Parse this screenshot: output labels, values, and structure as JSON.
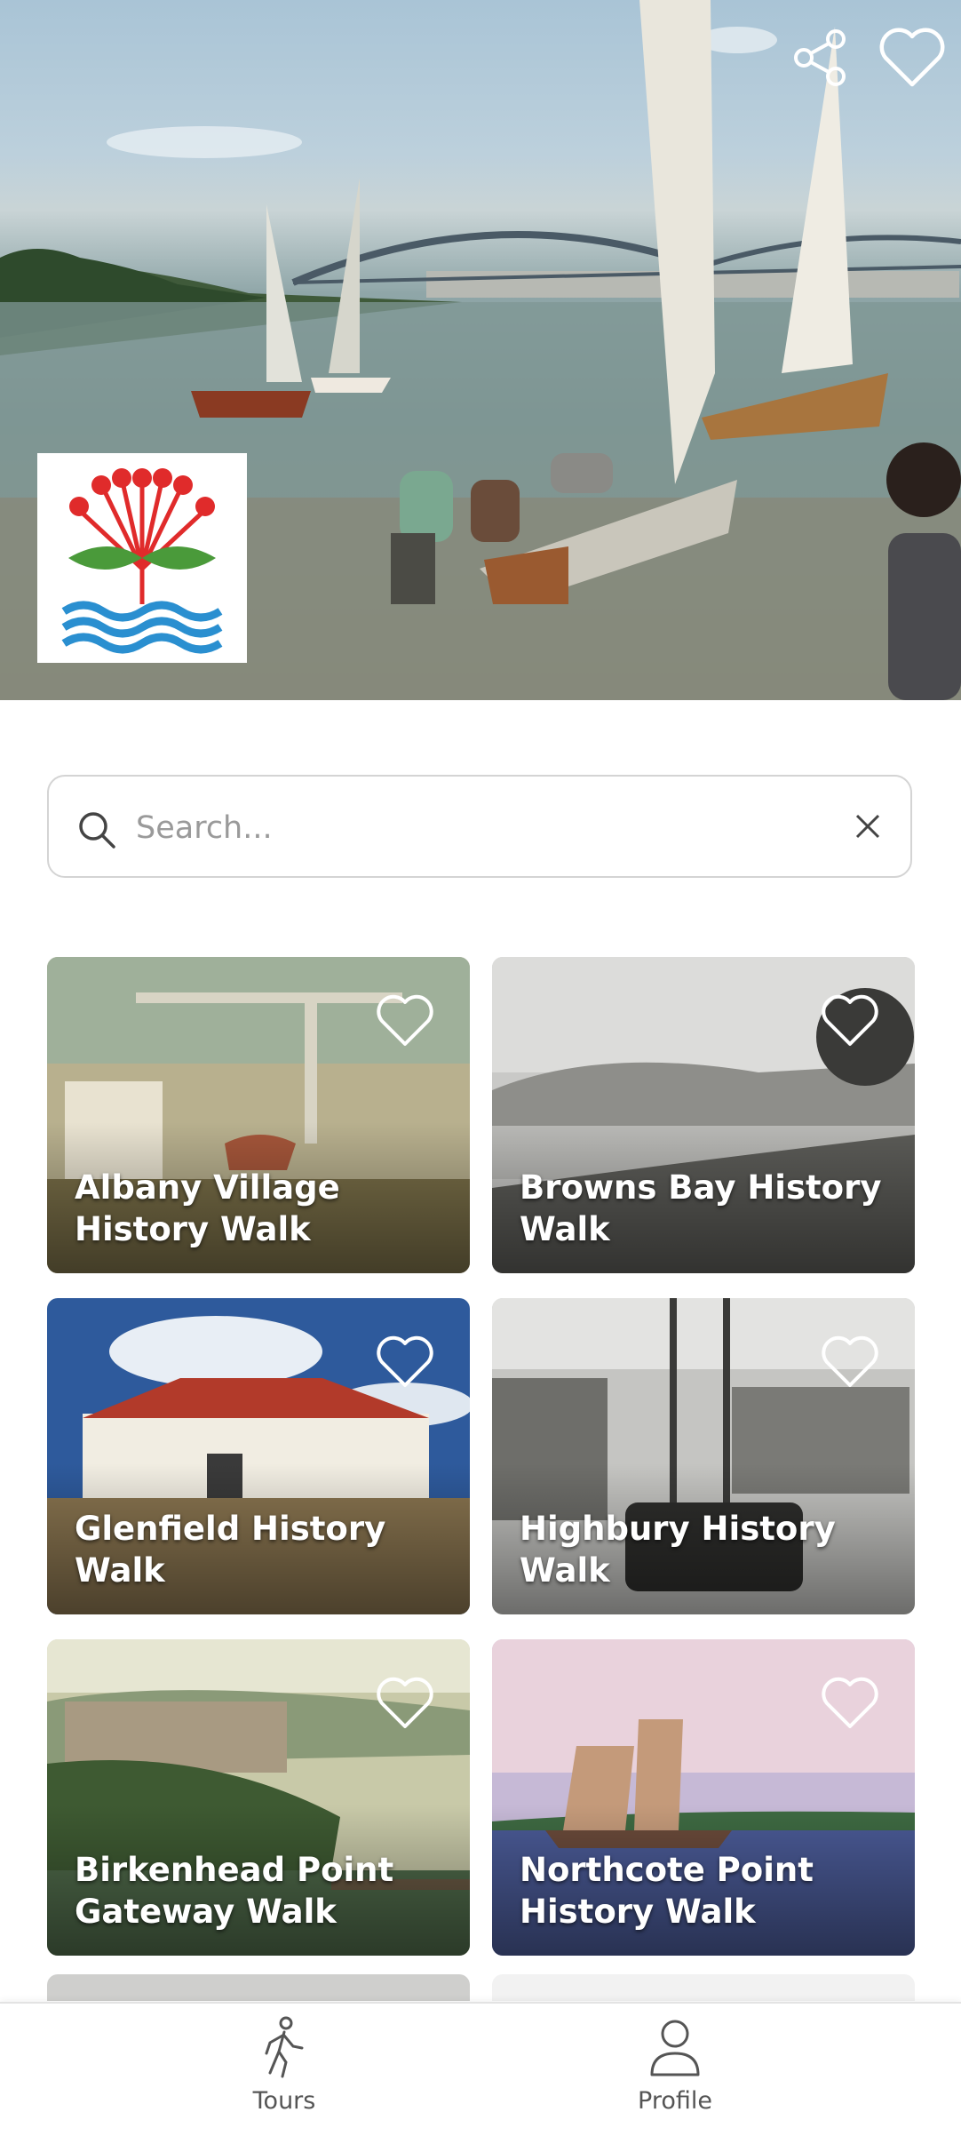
{
  "hero": {
    "image_name": "historic-sailing-dinghies-harbour-photo",
    "actions": {
      "share_icon": "share-icon",
      "favorite_icon": "heart-outline-icon"
    },
    "logo_name": "pohutukawa-flower-waves-logo"
  },
  "search": {
    "placeholder": "Search...",
    "value": "",
    "search_icon": "magnifier-icon",
    "clear_icon": "close-icon"
  },
  "walks": [
    {
      "title": "Albany Village History Walk",
      "favorite": false
    },
    {
      "title": "Browns Bay History Walk",
      "favorite": false
    },
    {
      "title": "Glenfield History Walk",
      "favorite": false
    },
    {
      "title": "Highbury History Walk",
      "favorite": false
    },
    {
      "title": "Birkenhead Point Gateway Walk",
      "favorite": false
    },
    {
      "title": "Northcote Point History Walk",
      "favorite": false
    }
  ],
  "bottom_nav": {
    "items": [
      {
        "label": "Tours",
        "icon": "walking-person-icon"
      },
      {
        "label": "Profile",
        "icon": "person-outline-icon"
      }
    ]
  },
  "colors": {
    "logo_flower": "#e02b2b",
    "logo_leaf": "#4a9a3a",
    "logo_waves": "#2a8fd0",
    "nav_text": "#555555"
  }
}
